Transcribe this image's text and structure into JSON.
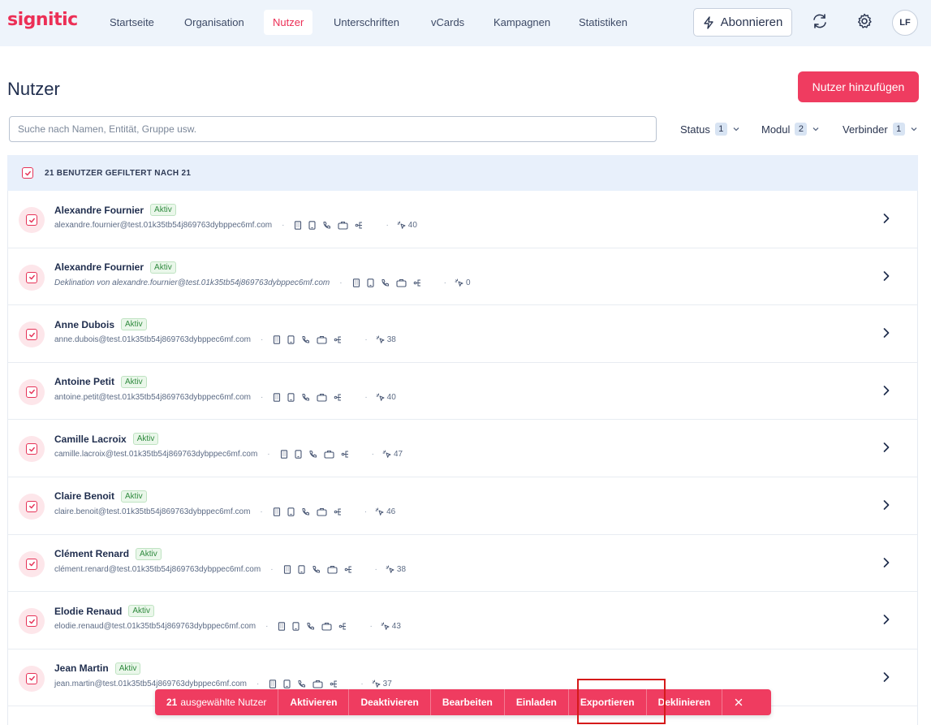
{
  "brand": {
    "logo": "signitic",
    "accent": "#ec2f56"
  },
  "nav": {
    "items": [
      {
        "label": "Startseite",
        "active": false
      },
      {
        "label": "Organisation",
        "active": false
      },
      {
        "label": "Nutzer",
        "active": true
      },
      {
        "label": "Unterschriften",
        "active": false
      },
      {
        "label": "vCards",
        "active": false
      },
      {
        "label": "Kampagnen",
        "active": false
      },
      {
        "label": "Statistiken",
        "active": false
      }
    ],
    "subscribe_label": "Abonnieren",
    "avatar_initials": "LF",
    "icons": [
      "bolt-icon",
      "sync-icon",
      "gear-icon"
    ]
  },
  "page": {
    "title": "Nutzer",
    "add_button": "Nutzer hinzufügen",
    "search_placeholder": "Suche nach Namen, Entität, Gruppe usw.",
    "filters": [
      {
        "label": "Status",
        "count": "1"
      },
      {
        "label": "Modul",
        "count": "2"
      },
      {
        "label": "Verbinder",
        "count": "1"
      }
    ]
  },
  "list": {
    "header": "21 BENUTZER GEFILTERT NACH 21",
    "users": [
      {
        "name": "Alexandre Fournier",
        "status": "Aktiv",
        "email": "alexandre.fournier@test.01k35tb54j869763dybppec6mf.com",
        "italic": false,
        "campaigns": "40"
      },
      {
        "name": "Alexandre Fournier",
        "status": "Aktiv",
        "email": "Deklination von alexandre.fournier@test.01k35tb54j869763dybppec6mf.com",
        "italic": true,
        "campaigns": "0"
      },
      {
        "name": "Anne Dubois",
        "status": "Aktiv",
        "email": "anne.dubois@test.01k35tb54j869763dybppec6mf.com",
        "italic": false,
        "campaigns": "38"
      },
      {
        "name": "Antoine Petit",
        "status": "Aktiv",
        "email": "antoine.petit@test.01k35tb54j869763dybppec6mf.com",
        "italic": false,
        "campaigns": "40"
      },
      {
        "name": "Camille Lacroix",
        "status": "Aktiv",
        "email": "camille.lacroix@test.01k35tb54j869763dybppec6mf.com",
        "italic": false,
        "campaigns": "47"
      },
      {
        "name": "Claire Benoit",
        "status": "Aktiv",
        "email": "claire.benoit@test.01k35tb54j869763dybppec6mf.com",
        "italic": false,
        "campaigns": "46"
      },
      {
        "name": "Clément Renard",
        "status": "Aktiv",
        "email": "clément.renard@test.01k35tb54j869763dybppec6mf.com",
        "italic": false,
        "campaigns": "38"
      },
      {
        "name": "Elodie Renaud",
        "status": "Aktiv",
        "email": "elodie.renaud@test.01k35tb54j869763dybppec6mf.com",
        "italic": false,
        "campaigns": "43"
      },
      {
        "name": "Jean Martin",
        "status": "Aktiv",
        "email": "jean.martin@test.01k35tb54j869763dybppec6mf.com",
        "italic": false,
        "campaigns": "37"
      }
    ]
  },
  "action_bar": {
    "selected_count": "21",
    "selected_label": "ausgewählte Nutzer",
    "actions": [
      "Aktivieren",
      "Deaktivieren",
      "Bearbeiten",
      "Einladen",
      "Exportieren",
      "Deklinieren"
    ],
    "close_icon": "close-icon"
  }
}
